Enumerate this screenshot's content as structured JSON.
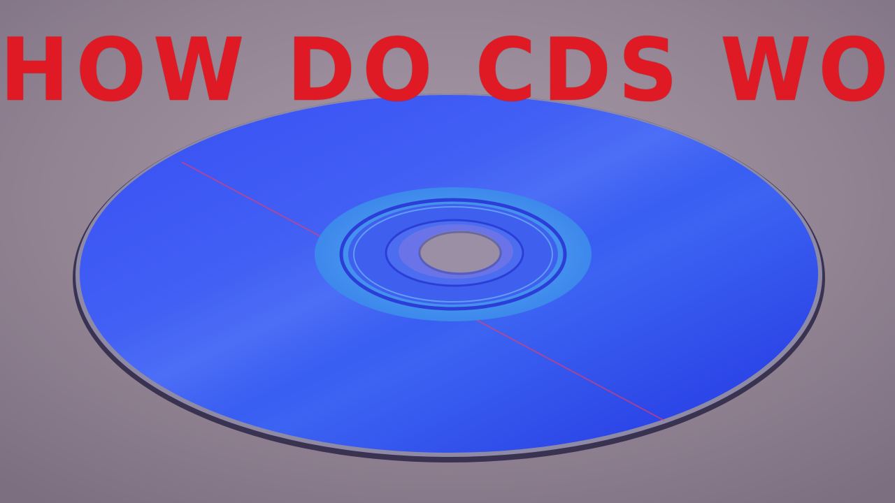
{
  "thumbnail": {
    "title": "HOW DO CDS WORK?"
  },
  "colors": {
    "title_red": "#e01a24",
    "background": "#8f8190",
    "disc_blue": "#2f3df2",
    "hub_teal": "#3a86ea",
    "laser_red": "#ff3a5a"
  },
  "scene": {
    "subject": "compact-disc",
    "subject_icon": "cd-icon"
  }
}
